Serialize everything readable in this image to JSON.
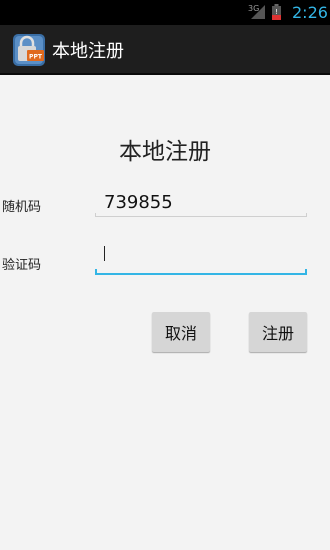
{
  "status_bar": {
    "network": "3G",
    "time": "2:26",
    "time_color": "#33b5e5"
  },
  "app_bar": {
    "title": "本地注册",
    "icon": "ppt-lock-app-icon"
  },
  "form": {
    "heading": "本地注册",
    "random_code_label": "随机码",
    "random_code_value": "739855",
    "verify_code_label": "验证码",
    "verify_code_value": "",
    "focus_color": "#33b5e5"
  },
  "buttons": {
    "cancel_label": "取消",
    "register_label": "注册"
  }
}
